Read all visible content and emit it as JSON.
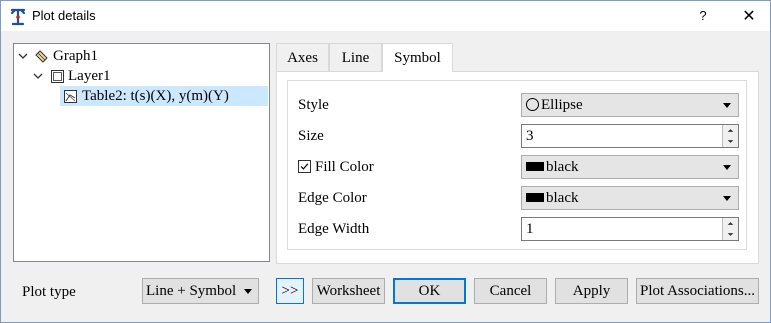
{
  "window": {
    "title": "Plot details",
    "help_label": "?",
    "close_label": "✕"
  },
  "tree": {
    "items": [
      {
        "label": "Graph1",
        "icon": "graph-icon",
        "expanded": true
      },
      {
        "label": "Layer1",
        "icon": "layer-icon",
        "expanded": true
      },
      {
        "label": "Table2: t(s)(X), y(m)(Y)",
        "icon": "plot-icon",
        "selected": true
      }
    ]
  },
  "tabs": [
    {
      "label": "Axes"
    },
    {
      "label": "Line"
    },
    {
      "label": "Symbol",
      "active": true
    }
  ],
  "symbol": {
    "style_label": "Style",
    "style_value": "Ellipse",
    "size_label": "Size",
    "size_value": "3",
    "fill_color_label": "Fill Color",
    "fill_color_checked": true,
    "fill_color_value": "black",
    "edge_color_label": "Edge Color",
    "edge_color_value": "black",
    "edge_width_label": "Edge Width",
    "edge_width_value": "1"
  },
  "bottom": {
    "plot_type_label": "Plot type",
    "plot_type_value": "Line + Symbol",
    "expand_label": ">>",
    "worksheet_label": "Worksheet",
    "ok_label": "OK",
    "cancel_label": "Cancel",
    "apply_label": "Apply",
    "plot_associations_label": "Plot Associations..."
  },
  "colors": {
    "selection": "#cce8ff",
    "accent": "#0078d7",
    "swatch_black": "#000000"
  }
}
